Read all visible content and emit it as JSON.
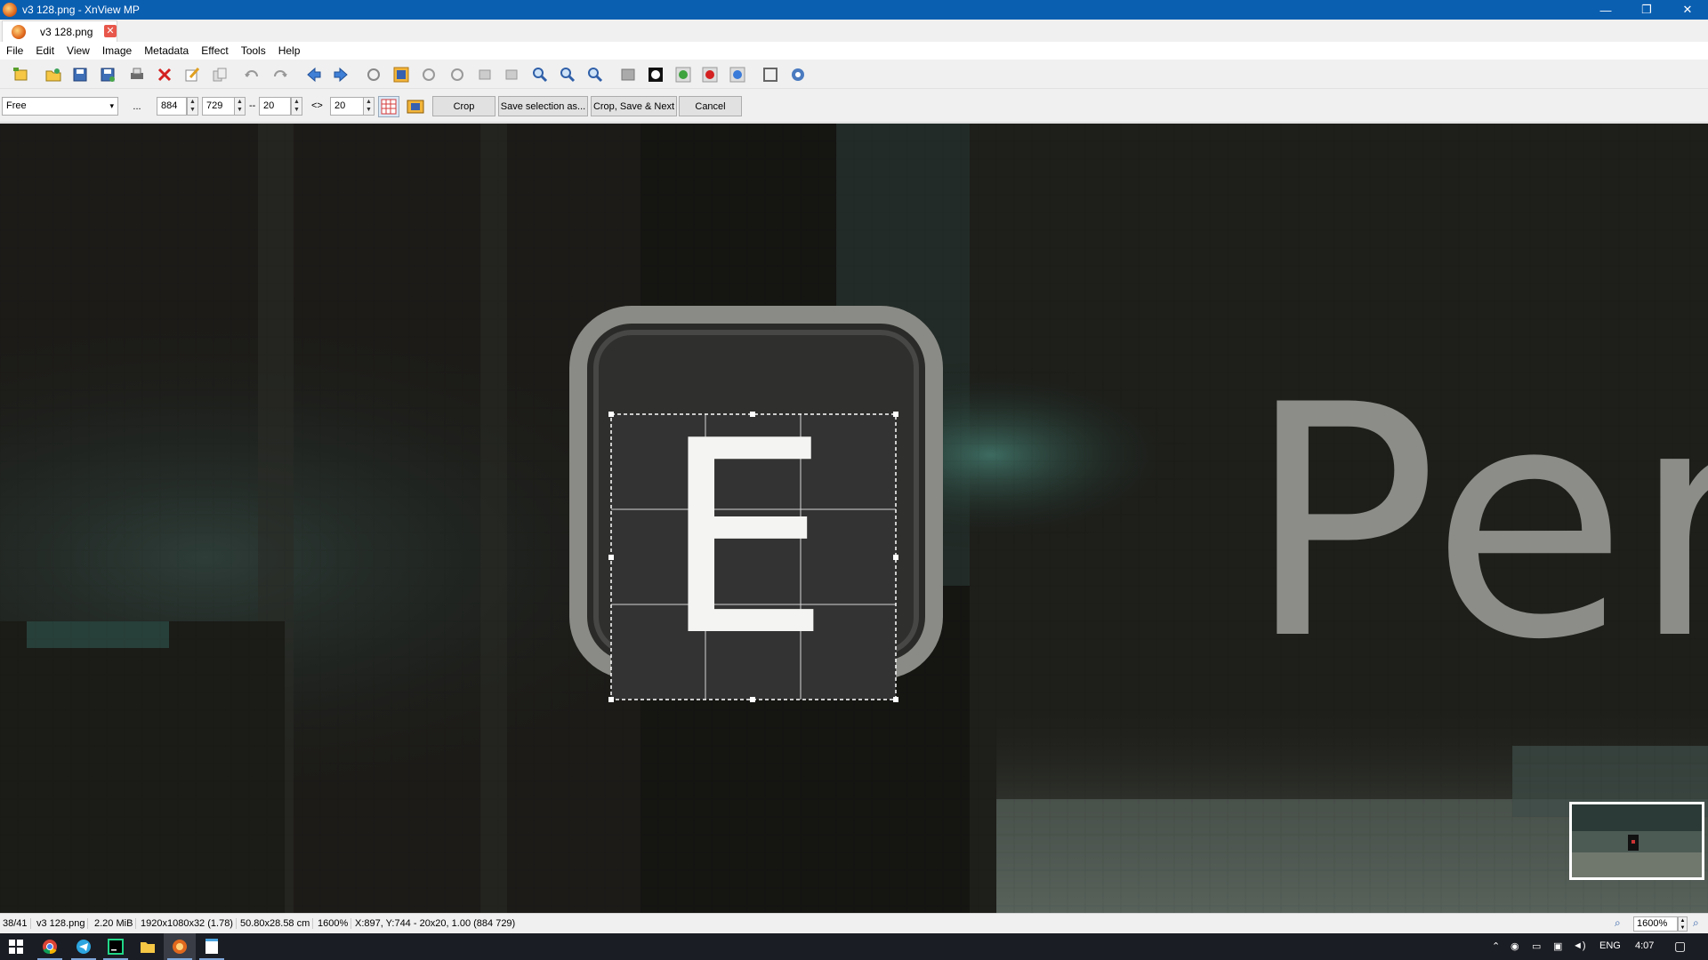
{
  "window": {
    "title": "v3 128.png - XnView MP",
    "controls": {
      "minimize": "—",
      "restore": "❐",
      "close": "✕"
    }
  },
  "tab": {
    "label": "v3 128.png",
    "close": "✕"
  },
  "menu": [
    "File",
    "Edit",
    "View",
    "Image",
    "Metadata",
    "Effect",
    "Tools",
    "Help"
  ],
  "toolbar": {
    "icons": [
      "browser-icon",
      "open-folder-icon",
      "save-icon",
      "save-as-icon",
      "print-icon",
      "delete-icon",
      "edit-icon",
      "copy-icon",
      "undo-icon",
      "redo-icon",
      "previous-icon",
      "next-icon",
      "refresh-icon",
      "crop-icon",
      "rotate-left-icon",
      "rotate-right-icon",
      "rotate-3d-icon",
      "flip-icon",
      "zoom-in-icon",
      "zoom-out-icon",
      "zoom-fit-icon",
      "adjust-icon",
      "levels-icon",
      "color-green-icon",
      "red-eye-icon",
      "color-blue-icon",
      "fullscreen-icon",
      "settings-icon"
    ]
  },
  "cropbar": {
    "ratio": "Free",
    "more": "...",
    "width": "884",
    "height": "729",
    "sep": "--",
    "size_w": "20",
    "swap": "<>",
    "size_h": "20",
    "crop": "Crop",
    "save_selection": "Save selection as...",
    "crop_save_next": "Crop, Save & Next",
    "cancel": "Cancel"
  },
  "canvas": {
    "letter": "E",
    "text": "Per"
  },
  "status": {
    "index": "38/41",
    "filename": "v3 128.png",
    "filesize": "2.20 MiB",
    "dimensions": "1920x1080x32 (1.78)",
    "print_size": "50.80x28.58 cm",
    "zoom": "1600%",
    "position": "X:897, Y:744 - 20x20, 1.00 (884 729)",
    "zoom_field": "1600%"
  },
  "taskbar": {
    "apps": [
      "windows-start-icon",
      "chrome-icon",
      "telegram-icon",
      "pycharm-icon",
      "file-explorer-icon",
      "xnview-icon",
      "notepad-icon"
    ],
    "lang": "ENG",
    "time": "4:07"
  },
  "colors": {
    "titlebar": "#0b5fb1",
    "taskbar": "#1b1d24",
    "canvas_dark": "#151512",
    "tab_close": "#e8574b"
  }
}
